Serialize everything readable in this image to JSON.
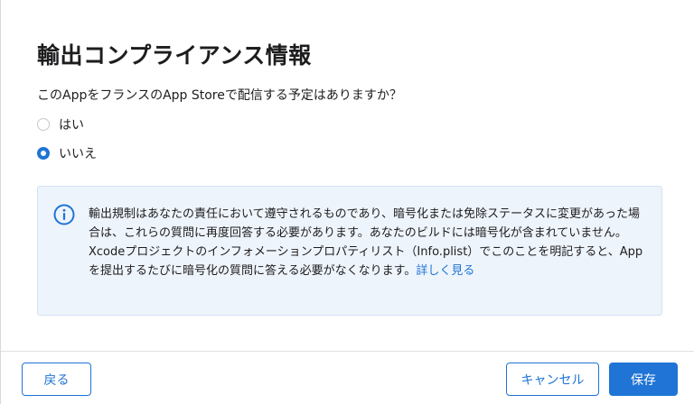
{
  "dialog": {
    "title": "輸出コンプライアンス情報",
    "question": "このAppをフランスのApp Storeで配信する予定はありますか？",
    "options": [
      {
        "label": "はい",
        "selected": false
      },
      {
        "label": "いいえ",
        "selected": true
      }
    ],
    "info": {
      "icon": "info-circle-icon",
      "text": "輸出規制はあなたの責任において遵守されるものであり、暗号化または免除ステータスに変更があった場合は、これらの質問に再度回答する必要があります。あなたのビルドには暗号化が含まれていません。Xcodeプロジェクトのインフォメーションプロパティリスト（Info.plist）でこのことを明記すると、Appを提出するたびに暗号化の質問に答える必要がなくなります。",
      "link_label": "詳しく見る"
    },
    "buttons": {
      "back": "戻る",
      "cancel": "キャンセル",
      "save": "保存"
    }
  },
  "colors": {
    "accent": "#1f74d6",
    "info_background": "#eef4fb"
  }
}
